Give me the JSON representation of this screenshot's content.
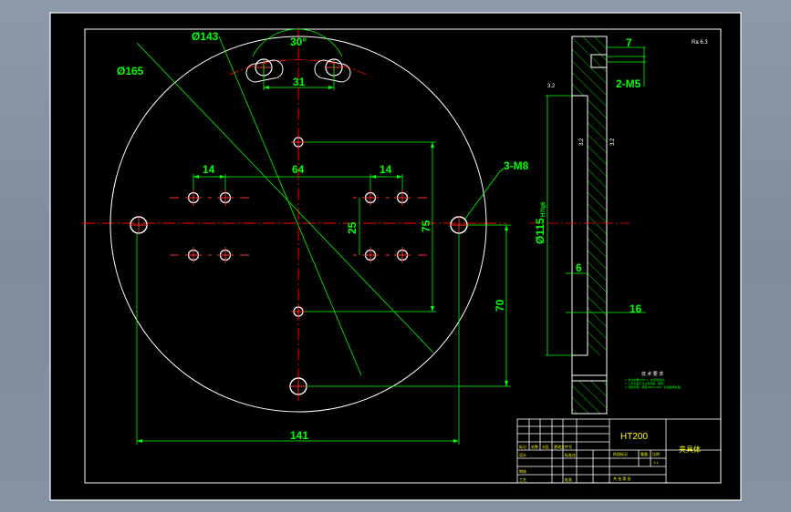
{
  "colors": {
    "window_bg": "#8b98a9",
    "canvas_bg": "#000000",
    "geometry": "#ffffff",
    "dimension": "#00ff00",
    "centerline": "#ff0000",
    "hole_center": "#ff3030",
    "hatch": "#00ff00",
    "title_text": "#ffff00",
    "label_text": "#ffff00"
  },
  "plan_view": {
    "outer_diameter": "Ø165",
    "bolt_circle_diameter": "Ø143",
    "slot_angle": "30°",
    "slot_chord": "31",
    "left_group_spacing": "14",
    "right_group_spacing": "14",
    "group_span": "64",
    "vertical_pitch": "25",
    "vertical_span": "75",
    "side_hole_callout": "3-M8",
    "bottom_offset": "70",
    "overall_width": "141"
  },
  "section_view": {
    "depth": "7",
    "thread_callout": "2-M5",
    "bore_callout": "Ø115",
    "bore_fit": "H7/g6",
    "inner_thickness": "6",
    "plate_thickness": "16",
    "roughness_top": "3.2",
    "roughness_a": "3.2",
    "roughness_b": "3.2"
  },
  "notes": {
    "title": "技 术 要 求",
    "lines": [
      "1. 未注倒角均为C1，去毛刺锐边。",
      "2. 工件表面不允许有划痕、碰伤。",
      "3. 调质处理，硬度HB220-250，表面发黑处理。"
    ]
  },
  "corner_mark": "Ra 6.3",
  "title_block": {
    "material": "HT200",
    "part_name": "夹具体",
    "scale": "1:1",
    "design_label": "设计",
    "check_label": "审核",
    "process_label": "工艺",
    "standard_label": "标准化",
    "approve_label": "批准",
    "stage_label": "阶段标记",
    "weight_label": "重量",
    "scale_label": "比例",
    "mark_label": "标记",
    "count_label": "处数",
    "zone_label": "分区",
    "change_label": "更改文件号",
    "sheet_label": "共 张 第 张"
  }
}
